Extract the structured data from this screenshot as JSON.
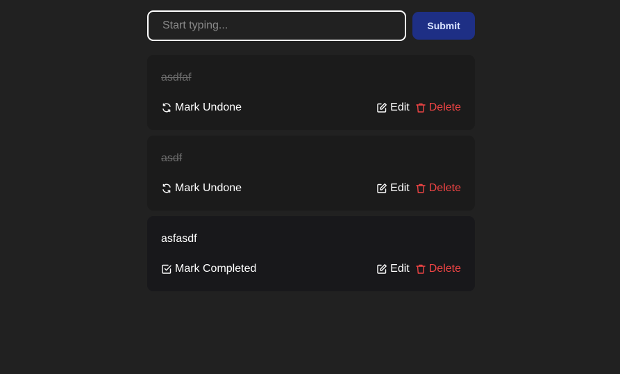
{
  "form": {
    "input_placeholder": "Start typing...",
    "input_value": "",
    "submit_label": "Submit"
  },
  "todos": [
    {
      "text": "asdfaf",
      "status": "done",
      "toggle_label": "Mark Undone",
      "toggle_icon": "refresh-icon",
      "edit_label": "Edit",
      "delete_label": "Delete"
    },
    {
      "text": "asdf",
      "status": "done",
      "toggle_label": "Mark Undone",
      "toggle_icon": "refresh-icon",
      "edit_label": "Edit",
      "delete_label": "Delete"
    },
    {
      "text": "asfasdf",
      "status": "pending",
      "toggle_label": "Mark Completed",
      "toggle_icon": "check-square-icon",
      "edit_label": "Edit",
      "delete_label": "Delete"
    }
  ],
  "colors": {
    "background": "#212121",
    "card_done": "#1b1b1b",
    "card_pending": "#18181b",
    "submit_bg": "#1e2f85",
    "delete": "#ef4444"
  }
}
